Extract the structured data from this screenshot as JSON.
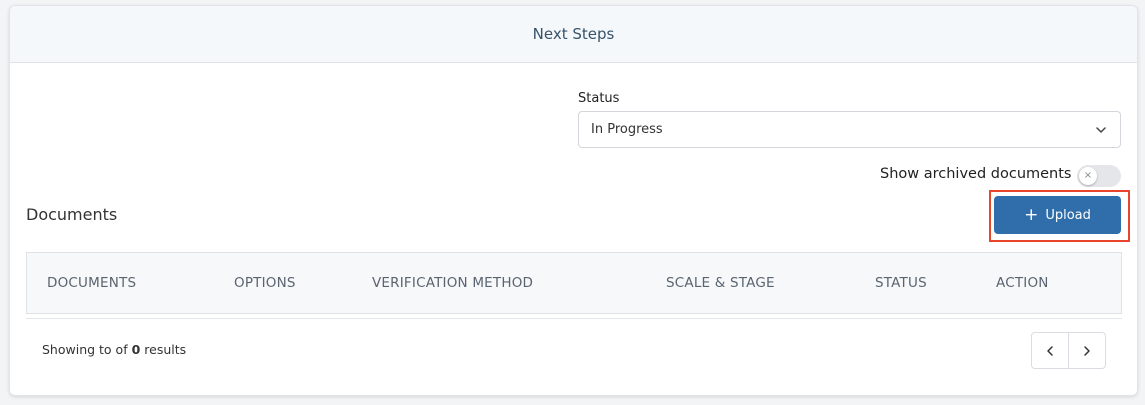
{
  "panel": {
    "title": "Next Steps"
  },
  "filters": {
    "status_label": "Status",
    "status_value": "In Progress",
    "archived_label": "Show archived documents",
    "archived_on": false
  },
  "documents": {
    "title": "Documents",
    "upload_label": "Upload",
    "columns": [
      "DOCUMENTS",
      "OPTIONS",
      "VERIFICATION METHOD",
      "SCALE & STAGE",
      "STATUS",
      "ACTION"
    ],
    "rows": []
  },
  "footer": {
    "results_prefix": "Showing to of",
    "results_count": "0",
    "results_suffix": "results"
  },
  "icons": {
    "status_chevron": "chevron-down-icon",
    "toggle_knob": "close-icon",
    "upload": "plus-icon",
    "prev": "chevron-left-icon",
    "next": "chevron-right-icon"
  },
  "colors": {
    "accent": "#2f6eaa",
    "highlight": "#e8452c",
    "header_bg": "#f5f8fa",
    "title_text": "#37526b"
  }
}
